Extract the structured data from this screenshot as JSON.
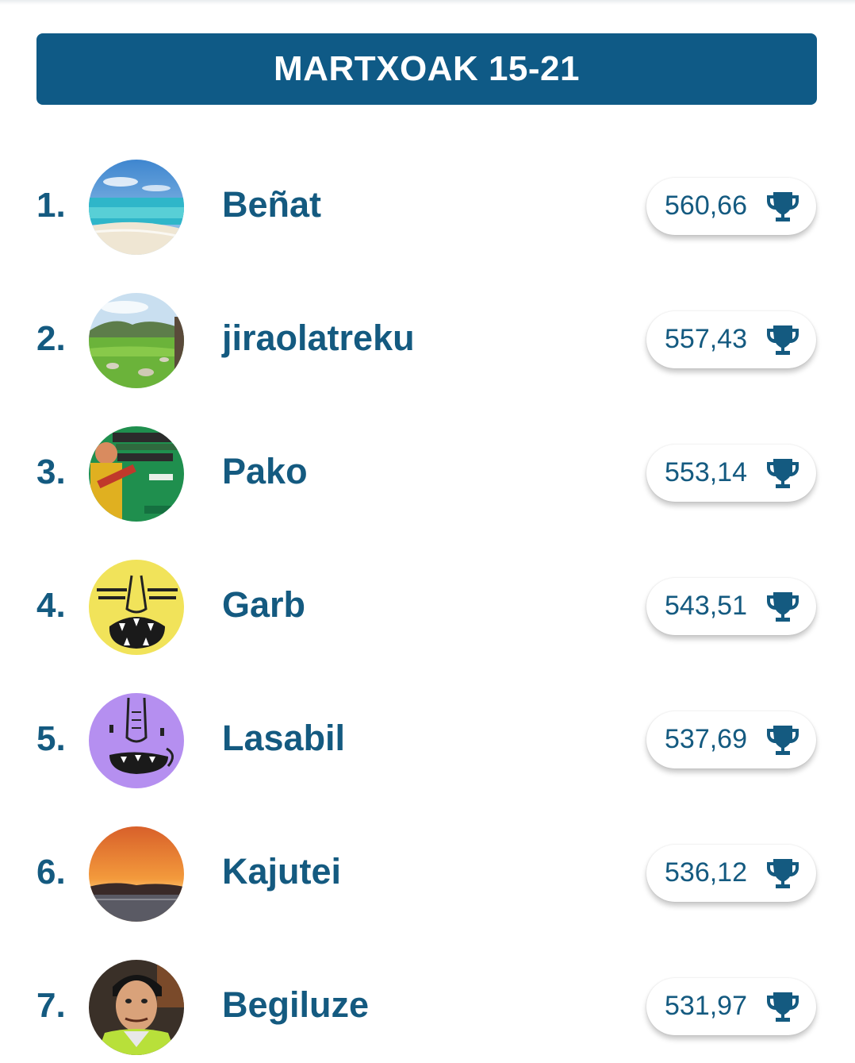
{
  "header": {
    "title": "MARTXOAK 15-21"
  },
  "leaderboard": [
    {
      "rank": "1.",
      "name": "Beñat",
      "score": "560,66",
      "avatar": "beach-photo"
    },
    {
      "rank": "2.",
      "name": "jiraolatreku",
      "score": "557,43",
      "avatar": "meadow-photo"
    },
    {
      "rank": "3.",
      "name": "Pako",
      "score": "553,14",
      "avatar": "guitar-poster-photo"
    },
    {
      "rank": "4.",
      "name": "Garb",
      "score": "543,51",
      "avatar": "yellow-face-cartoon"
    },
    {
      "rank": "5.",
      "name": "Lasabil",
      "score": "537,69",
      "avatar": "purple-face-cartoon"
    },
    {
      "rank": "6.",
      "name": "Kajutei",
      "score": "536,12",
      "avatar": "sunset-photo"
    },
    {
      "rank": "7.",
      "name": "Begiluze",
      "score": "531,97",
      "avatar": "man-portrait-photo"
    }
  ],
  "icons": {
    "score": "trophy-icon"
  },
  "colors": {
    "header_bg": "#0f5a86",
    "text_primary": "#145a80",
    "header_text": "#ffffff"
  }
}
